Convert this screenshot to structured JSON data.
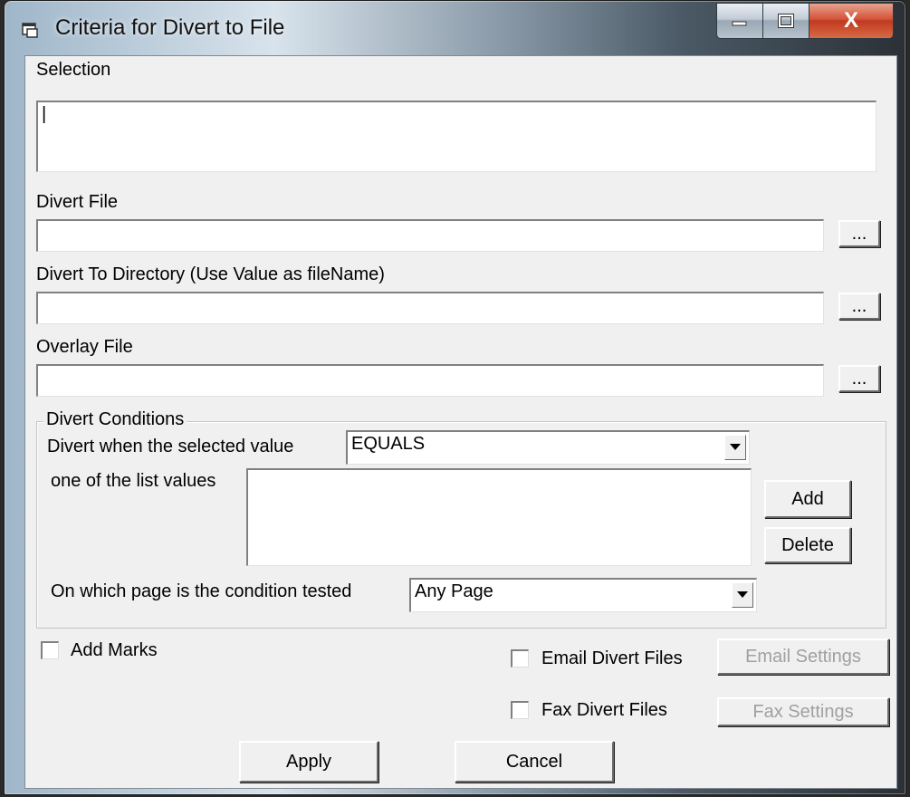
{
  "window": {
    "title": "Criteria for Divert to File",
    "close_glyph": "X"
  },
  "selection": {
    "label": "Selection",
    "value": "|"
  },
  "divert_file": {
    "label": "Divert File",
    "value": "",
    "browse_label": "..."
  },
  "divert_dir": {
    "label": "Divert To Directory (Use Value as fileName)",
    "value": "",
    "browse_label": "..."
  },
  "overlay_file": {
    "label": "Overlay File",
    "value": "",
    "browse_label": "..."
  },
  "conditions": {
    "group_label": "Divert Conditions",
    "operator_label": "Divert when the selected value",
    "operator_value": "EQUALS",
    "list_label": "one of the list values",
    "list_items": [],
    "add_label": "Add",
    "delete_label": "Delete",
    "page_label": "On which page is the condition tested",
    "page_value": "Any Page"
  },
  "options": {
    "add_marks": {
      "label": "Add Marks",
      "checked": false
    },
    "email_divert": {
      "label": "Email Divert Files",
      "checked": false
    },
    "email_settings_label": "Email Settings",
    "fax_divert": {
      "label": "Fax Divert Files",
      "checked": false
    },
    "fax_settings_label": "Fax Settings"
  },
  "footer": {
    "apply_label": "Apply",
    "cancel_label": "Cancel"
  },
  "icons": {
    "title": "window-app-icon",
    "minimize": "minimize-icon",
    "maximize": "maximize-icon",
    "close": "close-icon",
    "dropdown": "chevron-down-icon"
  },
  "colors": {
    "dialog_bg": "#f0f0f0",
    "close_button": "#c8412a",
    "disabled_text": "#a0a0a0"
  }
}
